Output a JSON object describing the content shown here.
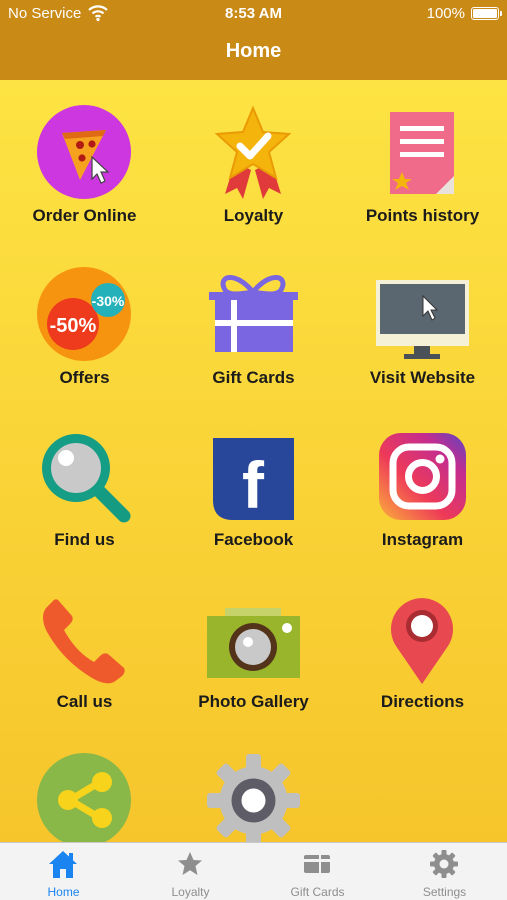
{
  "status_bar": {
    "carrier": "No Service",
    "time": "8:53 AM",
    "battery": "100%"
  },
  "header": {
    "title": "Home"
  },
  "tiles": [
    {
      "label": "Order Online",
      "icon": "pizza-order-icon"
    },
    {
      "label": "Loyalty",
      "icon": "badge-star-icon"
    },
    {
      "label": "Points history",
      "icon": "document-star-icon"
    },
    {
      "label": "Offers",
      "icon": "discount-tag-icon"
    },
    {
      "label": "Gift Cards",
      "icon": "gift-box-icon"
    },
    {
      "label": "Visit Website",
      "icon": "monitor-cursor-icon"
    },
    {
      "label": "Find us",
      "icon": "magnifier-icon"
    },
    {
      "label": "Facebook",
      "icon": "facebook-icon"
    },
    {
      "label": "Instagram",
      "icon": "instagram-icon"
    },
    {
      "label": "Call us",
      "icon": "phone-icon"
    },
    {
      "label": "Photo Gallery",
      "icon": "camera-icon"
    },
    {
      "label": "Directions",
      "icon": "map-pin-icon"
    },
    {
      "label": "",
      "icon": "share-icon"
    },
    {
      "label": "",
      "icon": "settings-gear-icon"
    }
  ],
  "tab_bar": {
    "items": [
      {
        "label": "Home",
        "icon": "home-icon",
        "active": true
      },
      {
        "label": "Loyalty",
        "icon": "star-icon",
        "active": false
      },
      {
        "label": "Gift Cards",
        "icon": "card-icon",
        "active": false
      },
      {
        "label": "Settings",
        "icon": "gear-icon",
        "active": false
      }
    ]
  },
  "colors": {
    "header": "#c98a16",
    "background": "#f7c72a",
    "active_tab": "#1a84f0",
    "inactive_tab": "#8e8e8e"
  }
}
